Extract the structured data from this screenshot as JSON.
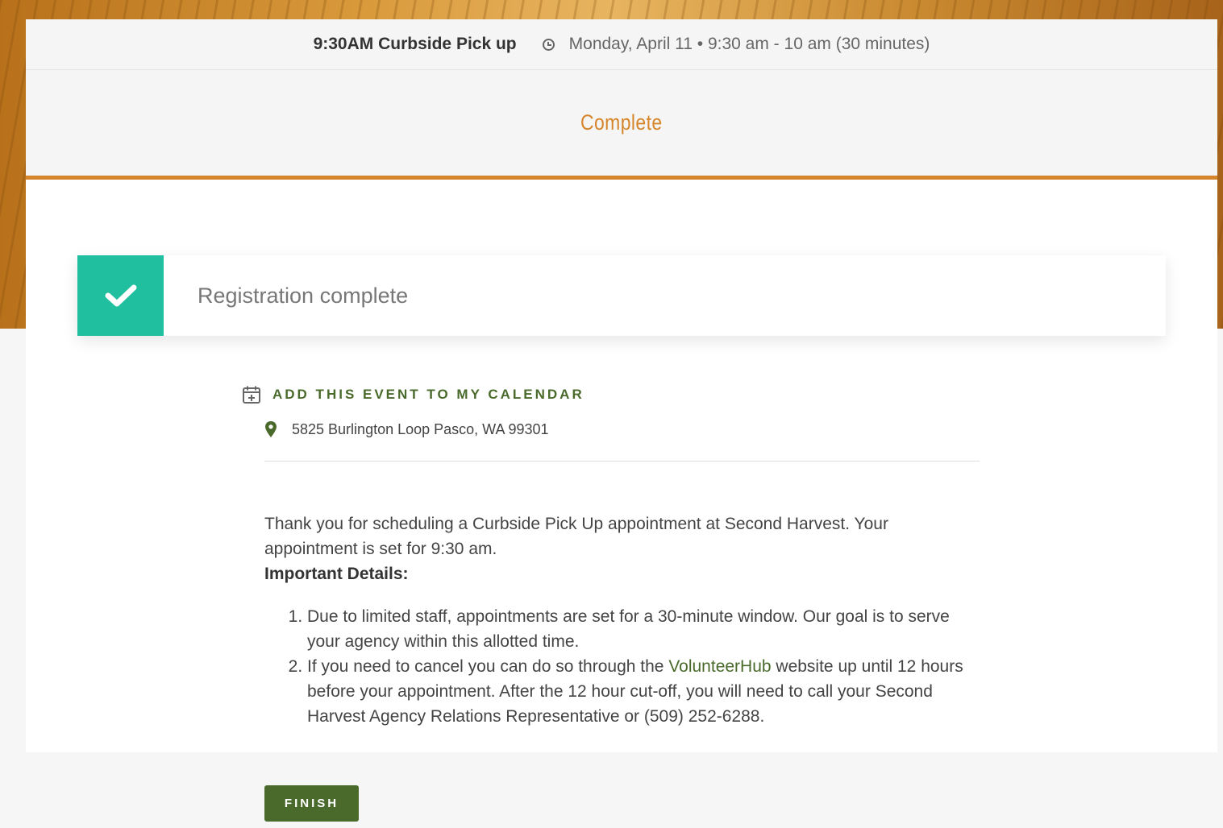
{
  "event": {
    "title": "9:30AM Curbside Pick up",
    "time": "Monday, April 11 • 9:30 am - 10 am (30 minutes)"
  },
  "step": {
    "label": "Complete"
  },
  "status": {
    "message": "Registration complete",
    "color": "#20bf9f"
  },
  "calendar": {
    "link_label": "ADD THIS EVENT TO MY CALENDAR"
  },
  "location": {
    "address": "5825 Burlington Loop Pasco, WA 99301"
  },
  "body": {
    "intro": "Thank you for scheduling a Curbside Pick Up appointment at Second Harvest. Your appointment is set for 9:30 am.",
    "details_heading": "Important Details:",
    "item1": "Due to limited staff, appointments are set for a 30-minute window. Our goal is to serve your agency within this allotted time.",
    "item2_before": "If you need to cancel you can do so through the ",
    "item2_link": "VolunteerHub",
    "item2_after": " website up until 12 hours before your appointment. After the 12 hour cut-off, you will need to call your Second Harvest Agency Relations Representative or (509) 252-6288."
  },
  "footer": {
    "finish_label": "FINISH"
  },
  "colors": {
    "accent_orange": "#d6852a",
    "brand_green": "#4a6a2c",
    "success": "#20bf9f"
  },
  "icons": [
    "clock-icon",
    "check-icon",
    "calendar-add-icon",
    "map-pin-icon"
  ]
}
